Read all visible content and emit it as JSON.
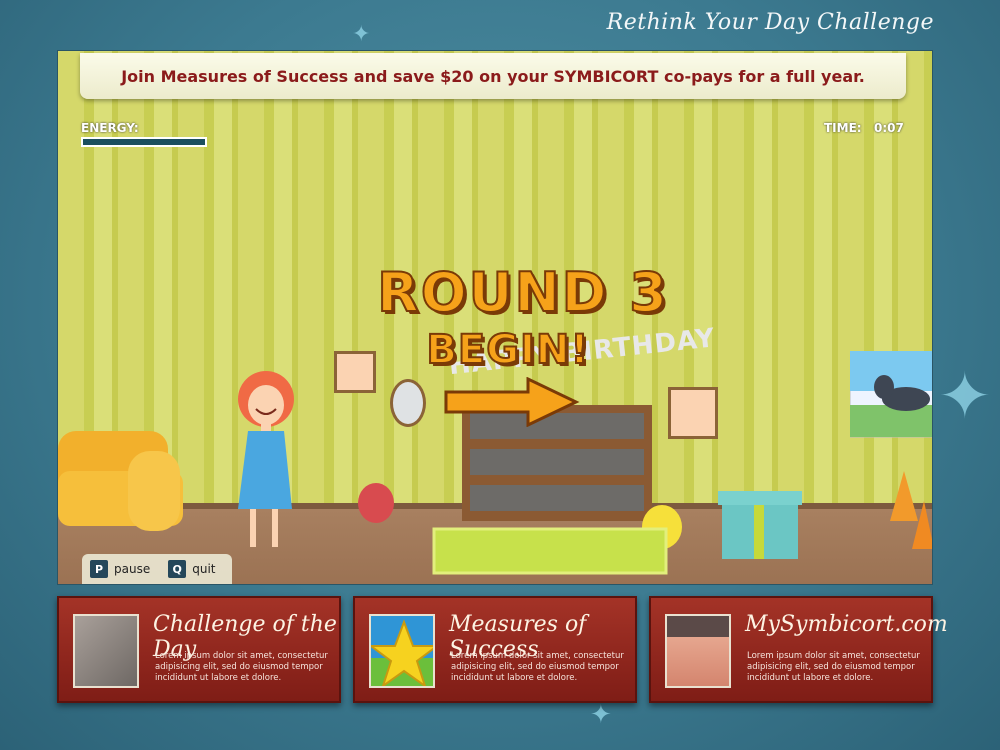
{
  "brand": {
    "title": "Rethink Your Day Challenge"
  },
  "promo": {
    "text": "Join Measures of Success and save $20 on your SYMBICORT co-pays for a full year."
  },
  "hud": {
    "energy_label": "ENERGY:",
    "energy_level": 1.0,
    "time_label": "TIME:",
    "time_value": "0:07"
  },
  "round": {
    "title": "ROUND 3",
    "subtitle": "BEGIN!"
  },
  "scene": {
    "banner_text": "HAPPY BIRTHDAY"
  },
  "controls": [
    {
      "key": "P",
      "label": "pause"
    },
    {
      "key": "Q",
      "label": "quit"
    }
  ],
  "cards": [
    {
      "title": "Challenge of the Day",
      "body": "Lorem ipsum dolor sit amet, consectetur adipisicing elit, sed do eiusmod tempor incididunt ut labore et dolore."
    },
    {
      "title": "Measures of Success",
      "body": "Lorem ipsum dolor sit amet, consectetur adipisicing elit, sed do eiusmod tempor incididunt ut labore et dolore."
    },
    {
      "title": "MySymbicort.com",
      "body": "Lorem ipsum dolor sit amet, consectetur adipisicing elit, sed do eiusmod tempor incididunt ut labore et dolore."
    }
  ],
  "colors": {
    "accent": "#f6a21a",
    "card_bg": "#8f2519",
    "promo_text": "#8b1b1b",
    "energy": "#1b4f5e"
  }
}
